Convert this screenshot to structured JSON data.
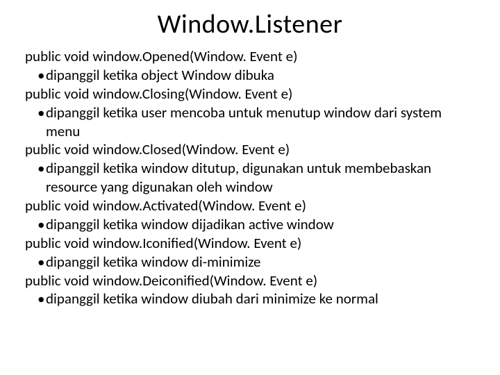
{
  "title": "Window.Listener",
  "items": [
    {
      "sig": "public void window.Opened(Window. Event e)",
      "desc": "dipanggil ketika object Window dibuka"
    },
    {
      "sig": "public void window.Closing(Window. Event e)",
      "desc": "dipanggil ketika user mencoba untuk menutup window dari system menu"
    },
    {
      "sig": "public void window.Closed(Window. Event e)",
      "desc": "dipanggil ketika window ditutup, digunakan untuk membebaskan resource yang digunakan oleh window"
    },
    {
      "sig": "public void window.Activated(Window. Event e)",
      "desc": "dipanggil ketika window dijadikan active window"
    },
    {
      "sig": "public void window.Iconified(Window. Event e)",
      "desc": "dipanggil ketika window di-minimize"
    },
    {
      "sig": "public void window.Deiconified(Window. Event e)",
      "desc": "dipanggil ketika window diubah dari minimize ke normal"
    }
  ],
  "bullet": "•"
}
